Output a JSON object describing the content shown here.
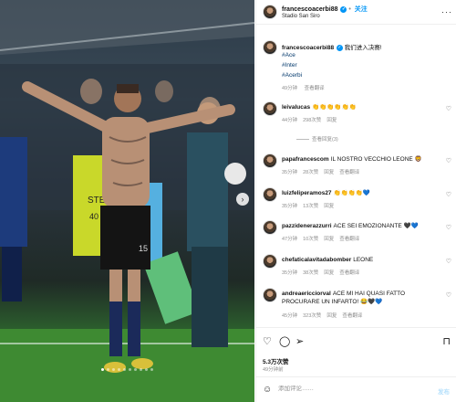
{
  "post": {
    "username": "francescoacerbi88",
    "follow_label": "关注",
    "location": "Stadio San Siro",
    "caption_text": "我们进入决赛!",
    "hashtags": [
      "#Ace",
      "#Inter",
      "#Acerbi"
    ],
    "caption_time": "49分钟",
    "caption_translate": "查看翻译",
    "likes": "5.3万次赞",
    "time_ago": "49分钟前",
    "comment_placeholder": "添加评论……",
    "post_label": "发布"
  },
  "comments": [
    {
      "user": "leivalucas",
      "text": "👏👏👏👏👏👏",
      "time": "44分钟",
      "likes": "298次赞",
      "reply": "回复",
      "translate": "",
      "view_replies": "查看回复(3)"
    },
    {
      "user": "papafrancescom",
      "text": "IL NOSTRO VECCHIO LEONE 🦁",
      "time": "35分钟",
      "likes": "28次赞",
      "reply": "回复",
      "translate": "查看翻译",
      "view_replies": ""
    },
    {
      "user": "luizfeliperamos27",
      "text": "👏👏👏👏💙",
      "time": "35分钟",
      "likes": "13次赞",
      "reply": "回复",
      "translate": "",
      "view_replies": ""
    },
    {
      "user": "pazzidenerazzurri",
      "text": "ACE SEI EMOZIONANTE 🖤💙",
      "time": "47分钟",
      "likes": "10次赞",
      "reply": "回复",
      "translate": "查看翻译",
      "view_replies": ""
    },
    {
      "user": "chefaticalavitadabomber",
      "text": "LEONE",
      "time": "35分钟",
      "likes": "38次赞",
      "reply": "回复",
      "translate": "查看翻译",
      "view_replies": ""
    },
    {
      "user": "andreaericciorval",
      "text": "ACE MI HAI QUASI FATTO PROCURARE UN INFARTO! 😂🖤💙",
      "time": "45分钟",
      "likes": "323次赞",
      "reply": "回复",
      "translate": "查看翻译",
      "view_replies": ""
    }
  ],
  "photo": {
    "sponsor_text": "STEW",
    "player_number": "15",
    "keeper_number": "40"
  }
}
